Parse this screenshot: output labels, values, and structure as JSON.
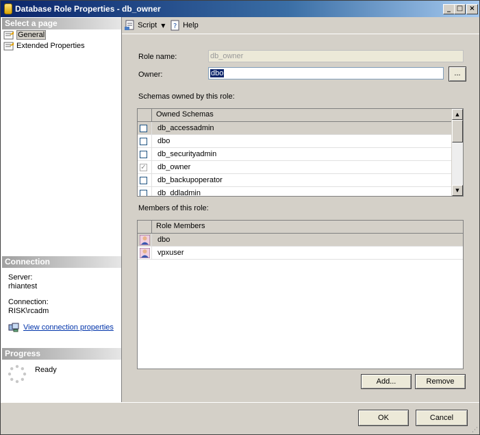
{
  "window": {
    "title": "Database Role Properties - db_owner"
  },
  "left": {
    "select_page_header": "Select a page",
    "pages": [
      {
        "label": "General"
      },
      {
        "label": "Extended Properties"
      }
    ],
    "connection_header": "Connection",
    "server_label": "Server:",
    "server_value": "rhiantest",
    "connection_label": "Connection:",
    "connection_value": "RISK\\rcadm",
    "view_connection_link": "View connection properties",
    "progress_header": "Progress",
    "progress_status": "Ready"
  },
  "toolbar": {
    "script_label": "Script",
    "help_label": "Help"
  },
  "general": {
    "role_name_label": "Role name:",
    "role_name_value": "db_owner",
    "owner_label": "Owner:",
    "owner_value": "dbo",
    "browse_label": "...",
    "schemas_label": "Schemas owned by this role:",
    "schemas_column": "Owned Schemas",
    "schemas": [
      {
        "name": "db_accessadmin",
        "checked": false
      },
      {
        "name": "dbo",
        "checked": false
      },
      {
        "name": "db_securityadmin",
        "checked": false
      },
      {
        "name": "db_owner",
        "checked": true
      },
      {
        "name": "db_backupoperator",
        "checked": false
      },
      {
        "name": "db_ddladmin",
        "checked": false
      }
    ],
    "members_label": "Members of this role:",
    "members_column": "Role Members",
    "members": [
      {
        "name": "dbo"
      },
      {
        "name": "vpxuser"
      }
    ],
    "add_button": "Add...",
    "remove_button": "Remove"
  },
  "footer": {
    "ok_button": "OK",
    "cancel_button": "Cancel"
  }
}
